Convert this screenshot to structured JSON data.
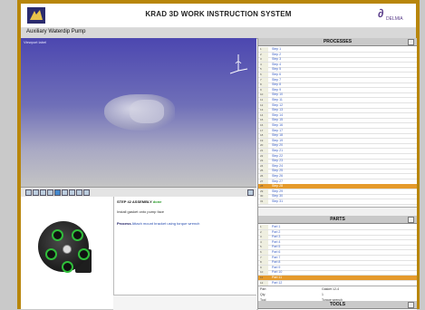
{
  "header": {
    "title": "KRAD 3D WORK INSTRUCTION SYSTEM",
    "logo_right": "DELMIA",
    "logo_left": "KRAD logo"
  },
  "subbar": {
    "assembly_title": "Auxiliary Waterdip Pump"
  },
  "viewport": {
    "label": "Viewport label"
  },
  "instruction": {
    "line1": "STEP 42 ASSEMBLY",
    "line1_tag": "done",
    "line2": "Install gasket onto pump face",
    "line3_tag": "Process",
    "line3": "Attach mount bracket using torque wrench"
  },
  "processes": {
    "header": "PROCESSES",
    "rows": [
      "Step 1",
      "Step 2",
      "Step 3",
      "Step 4",
      "Step 5",
      "Step 6",
      "Step 7",
      "Step 8",
      "Step 9",
      "Step 10",
      "Step 11",
      "Step 12",
      "Step 13",
      "Step 14",
      "Step 15",
      "Step 16",
      "Step 17",
      "Step 18",
      "Step 19",
      "Step 20",
      "Step 21",
      "Step 22",
      "Step 23",
      "Step 24",
      "Step 25",
      "Step 26",
      "Step 27",
      "Step 28",
      "Step 29",
      "Step 30",
      "Step 31"
    ],
    "highlighted_index": 27
  },
  "parts": {
    "header": "PARTS",
    "rows": [
      "Part 1",
      "Part 2",
      "Part 3",
      "Part 4",
      "Part 5",
      "Part 6",
      "Part 7",
      "Part 8",
      "Part 9",
      "Part 10",
      "Part 11",
      "Part 12"
    ],
    "highlighted_index": 10
  },
  "info": {
    "rows": [
      {
        "k": "Part",
        "v": "Gasket 12-4"
      },
      {
        "k": "Qty",
        "v": "1"
      },
      {
        "k": "Tool",
        "v": "Torque wrench"
      }
    ]
  },
  "bottom_panel": {
    "header": "TOOLS"
  },
  "colors": {
    "frame": "#b8860b",
    "highlight": "#e59a2b",
    "link": "#3b5fc4"
  }
}
